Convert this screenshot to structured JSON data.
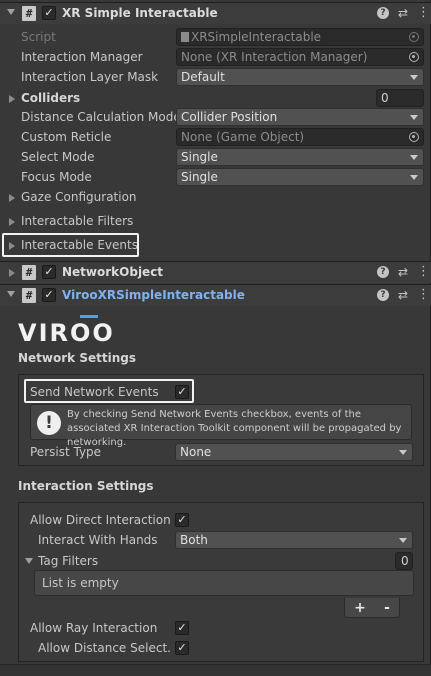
{
  "components": {
    "xr_simple": {
      "title": "XR Simple Interactable",
      "rows": [
        {
          "label": "Script",
          "value": "XRSimpleInteractable"
        },
        {
          "label": "Interaction Manager",
          "value": "None (XR Interaction Manager)"
        },
        {
          "label": "Interaction Layer Mask",
          "value": "Default"
        },
        {
          "label": "Colliders",
          "value": "0"
        },
        {
          "label": "Distance Calculation Mode",
          "value": "Collider Position"
        },
        {
          "label": "Custom Reticle",
          "value": "None (Game Object)"
        },
        {
          "label": "Select Mode",
          "value": "Single"
        },
        {
          "label": "Focus Mode",
          "value": "Single"
        },
        {
          "label": "Gaze Configuration"
        },
        {
          "label": "Interactable Filters"
        },
        {
          "label": "Interactable Events"
        }
      ]
    },
    "network_object": {
      "title": "NetworkObject"
    },
    "viroo": {
      "title": "VirooXRSimpleInteractable",
      "logo_text": "VIROO",
      "network_settings": {
        "heading": "Network Settings",
        "send_label": "Send Network Events",
        "send_checked": true,
        "info": "By checking Send Network Events checkbox, events of the associated XR Interaction Toolkit component will be propagated by networking.",
        "persist_label": "Persist Type",
        "persist_value": "None"
      },
      "interaction_settings": {
        "heading": "Interaction Settings",
        "allow_direct_label": "Allow Direct Interaction",
        "interact_hands_label": "Interact With Hands",
        "interact_hands_value": "Both",
        "tag_filters_label": "Tag Filters",
        "tag_filters_count": "0",
        "list_empty": "List is empty",
        "plus": "+",
        "minus": "-",
        "allow_ray_label": "Allow Ray Interaction",
        "allow_distance_label": "Allow Distance Select..."
      }
    }
  },
  "icons": {
    "help": "?",
    "presets": "⇄",
    "menu": "⋮",
    "check": "✓",
    "script": "#"
  }
}
